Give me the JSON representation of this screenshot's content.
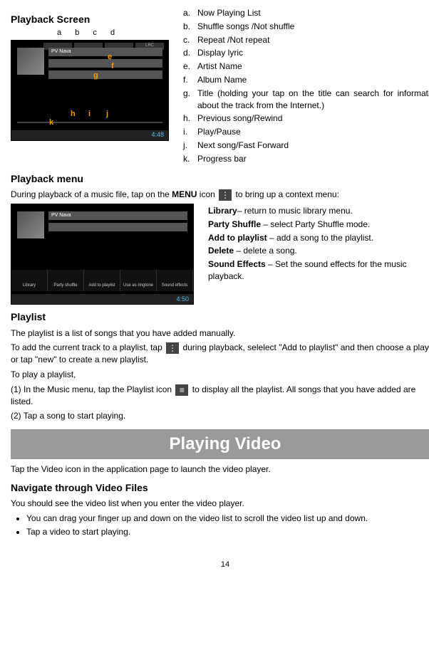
{
  "playback_screen": {
    "title": "Playback Screen",
    "labels": {
      "a": "a",
      "b": "b",
      "c": "c",
      "d": "d",
      "e": "e",
      "f": "f",
      "g": "g",
      "h": "h",
      "i": "i",
      "j": "j",
      "k": "k"
    },
    "track_artist": "PV Nava",
    "status_time": "4:48",
    "legend": [
      {
        "lt": "a.",
        "txt": "Now Playing List"
      },
      {
        "lt": "b.",
        "txt": "Shuffle songs /Not shuffle"
      },
      {
        "lt": "c.",
        "txt": "Repeat /Not repeat"
      },
      {
        "lt": "d.",
        "txt": "Display lyric"
      },
      {
        "lt": "e.",
        "txt": "Artist Name"
      },
      {
        "lt": "f.",
        "txt": "Album Name"
      },
      {
        "lt": "g.",
        "txt": "Title (holding your tap on the title can search for information about the track from the Internet.)"
      },
      {
        "lt": "h.",
        "txt": "Previous song/Rewind"
      },
      {
        "lt": "i.",
        "txt": "Play/Pause"
      },
      {
        "lt": "j.",
        "txt": "Next song/Fast Forward"
      },
      {
        "lt": "k.",
        "txt": "Progress bar"
      }
    ]
  },
  "playback_menu": {
    "title": "Playback menu",
    "intro_pre": "During playback of a music file, tap on the ",
    "intro_bold": "MENU",
    "intro_mid": " icon ",
    "intro_post": " to bring up a context menu:",
    "status_time": "4:50",
    "menu_items": [
      "Library",
      "Party shuffle",
      "Add to playlist",
      "Use as ringtone",
      "Sound effects"
    ],
    "defs": [
      {
        "bold": "Library",
        "txt": "– return to music library menu."
      },
      {
        "bold": "Party Shuffle",
        "txt": " – select Party Shuffle mode."
      },
      {
        "bold": "Add to playlist",
        "txt": " – add a song to the playlist."
      },
      {
        "bold": "Delete",
        "txt": " – delete a song."
      },
      {
        "bold": "Sound Effects",
        "txt": " – Set the sound effects for the music playback."
      }
    ]
  },
  "playlist": {
    "title": "Playlist",
    "p1": "The playlist is a list of songs that you have added manually.",
    "p2a": "To add the current track to a playlist, tap ",
    "p2b": " during playback, selelect \"Add to playlist\" and then choose a playlist or tap \"new\" to create a new playlist.",
    "p3": "To play a playlist,",
    "step1a": "(1) In the Music menu, tap the Playlist icon ",
    "step1b": " to display all the playlist. All songs that you have added are listed.",
    "step2": "(2) Tap a song to start playing."
  },
  "video": {
    "banner": "Playing Video",
    "intro": "Tap the Video icon in the application page to launch the video player.",
    "nav_title": "Navigate through Video Files",
    "nav_intro": "You should see the video list when you enter the video player.",
    "bullets": [
      "You can drag your finger up and down on the video list to scroll the video list up and down.",
      "Tap a video to start playing."
    ]
  },
  "page_num": "14",
  "icons": {
    "menu_dots": "⋮",
    "playlist_lines": "≡"
  }
}
